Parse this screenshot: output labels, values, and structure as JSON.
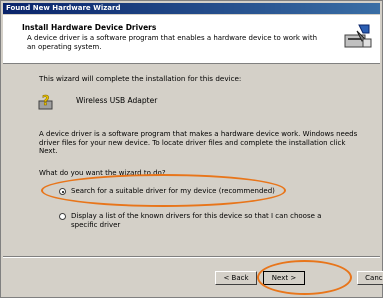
{
  "window": {
    "title": "Found New Hardware Wizard"
  },
  "header": {
    "title": "Install Hardware Device Drivers",
    "subtitle": "A device driver is a software program that enables a hardware device to work with an operating system."
  },
  "body": {
    "intro": "This wizard will complete the installation for this device:",
    "device_name": "Wireless USB Adapter",
    "description": "A device driver is a software program that makes a hardware device work. Windows needs driver files for your new device. To locate driver files and complete the installation click Next.",
    "question": "What do you want the wizard to do?",
    "options": [
      {
        "label": "Search for a suitable driver for my device (recommended)",
        "selected": true
      },
      {
        "label": "Display a list of the known drivers for this device so that I can choose a specific driver",
        "selected": false
      }
    ]
  },
  "buttons": {
    "back": "< Back",
    "next": "Next >",
    "cancel": "Cancel"
  },
  "colors": {
    "titlebar": "#0a246a",
    "highlight_oval": "#e8751a",
    "dialog": "#d4d0c8"
  },
  "icons": {
    "header": "hardware-wizard-icon",
    "device": "unknown-device-icon"
  }
}
